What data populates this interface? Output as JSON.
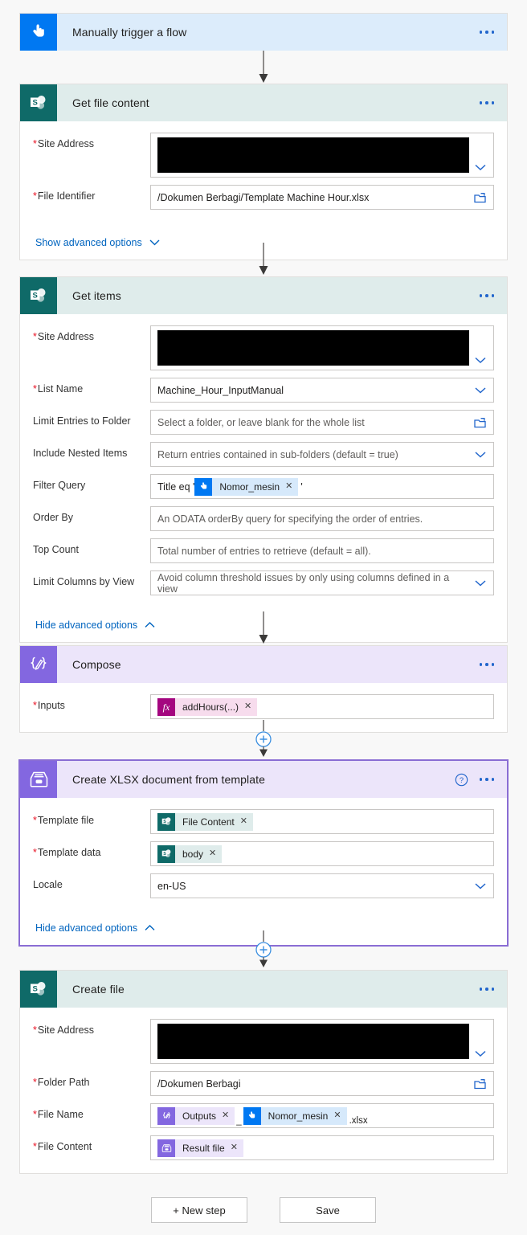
{
  "flow": {
    "steps": [
      {
        "id": "manual-trigger",
        "title": "Manually trigger a flow",
        "icon": "tap-hand-icon",
        "theme": "blue",
        "collapsed": true
      },
      {
        "id": "get-file-content",
        "title": "Get file content",
        "icon": "sharepoint-icon",
        "theme": "teal",
        "fields": [
          {
            "label": "Site Address",
            "required": true,
            "value": "",
            "redacted": true,
            "control": "dropdown"
          },
          {
            "label": "File Identifier",
            "required": true,
            "value": "/Dokumen Berbagi/Template Machine Hour.xlsx",
            "control": "folder-picker"
          }
        ],
        "advanced_label": "Show advanced options",
        "advanced_state": "collapsed"
      },
      {
        "id": "get-items",
        "title": "Get items",
        "icon": "sharepoint-icon",
        "theme": "teal",
        "fields": [
          {
            "label": "Site Address",
            "required": true,
            "value": "",
            "redacted": true,
            "control": "dropdown"
          },
          {
            "label": "List Name",
            "required": true,
            "value": "Machine_Hour_InputManual",
            "control": "dropdown"
          },
          {
            "label": "Limit Entries to Folder",
            "required": false,
            "placeholder": "Select a folder, or leave blank for the whole list",
            "control": "folder-picker"
          },
          {
            "label": "Include Nested Items",
            "required": false,
            "placeholder": "Return entries contained in sub-folders (default = true)",
            "control": "dropdown"
          },
          {
            "label": "Filter Query",
            "required": false,
            "control": "tokens",
            "tokens": [
              {
                "kind": "text",
                "text": "Title eq '"
              },
              {
                "kind": "token",
                "label": "Nomor_mesin",
                "icon": "tap-hand-icon",
                "theme": "blue"
              },
              {
                "kind": "text",
                "text": "'"
              }
            ]
          },
          {
            "label": "Order By",
            "required": false,
            "placeholder": "An ODATA orderBy query for specifying the order of entries.",
            "control": "text"
          },
          {
            "label": "Top Count",
            "required": false,
            "placeholder": "Total number of entries to retrieve (default = all).",
            "control": "text"
          },
          {
            "label": "Limit Columns by View",
            "required": false,
            "placeholder": "Avoid column threshold issues by only using columns defined in a view",
            "control": "dropdown"
          }
        ],
        "advanced_label": "Hide advanced options",
        "advanced_state": "expanded"
      },
      {
        "id": "compose",
        "title": "Compose",
        "icon": "compose-braces-icon",
        "theme": "purple",
        "fields": [
          {
            "label": "Inputs",
            "required": true,
            "control": "tokens",
            "tokens": [
              {
                "kind": "token",
                "label": "addHours(...)",
                "icon": "function-fx-icon",
                "theme": "magenta"
              }
            ]
          }
        ]
      },
      {
        "id": "create-xlsx-from-template",
        "title": "Create XLSX document from template",
        "icon": "file-box-icon",
        "theme": "purple",
        "selected": true,
        "has_help": true,
        "fields": [
          {
            "label": "Template file",
            "required": true,
            "control": "tokens",
            "tokens": [
              {
                "kind": "token",
                "label": "File Content",
                "icon": "sharepoint-icon",
                "theme": "teal"
              }
            ]
          },
          {
            "label": "Template data",
            "required": true,
            "control": "tokens",
            "tokens": [
              {
                "kind": "token",
                "label": "body",
                "icon": "sharepoint-icon",
                "theme": "teal"
              }
            ]
          },
          {
            "label": "Locale",
            "required": false,
            "value": "en-US",
            "control": "dropdown"
          }
        ],
        "advanced_label": "Hide advanced options",
        "advanced_state": "expanded"
      },
      {
        "id": "create-file",
        "title": "Create file",
        "icon": "sharepoint-icon",
        "theme": "teal",
        "fields": [
          {
            "label": "Site Address",
            "required": true,
            "value": "",
            "redacted": true,
            "control": "dropdown"
          },
          {
            "label": "Folder Path",
            "required": true,
            "value": "/Dokumen Berbagi",
            "control": "folder-picker"
          },
          {
            "label": "File Name",
            "required": true,
            "control": "tokens",
            "tokens": [
              {
                "kind": "token",
                "label": "Outputs",
                "icon": "compose-braces-icon",
                "theme": "purple"
              },
              {
                "kind": "text",
                "text": "_"
              },
              {
                "kind": "token",
                "label": "Nomor_mesin",
                "icon": "tap-hand-icon",
                "theme": "blue"
              },
              {
                "kind": "text",
                "text": ".xlsx"
              }
            ]
          },
          {
            "label": "File Content",
            "required": true,
            "control": "tokens",
            "tokens": [
              {
                "kind": "token",
                "label": "Result file",
                "icon": "file-box-icon",
                "theme": "purple"
              }
            ]
          }
        ]
      }
    ],
    "insert_buttons": [
      {
        "id": "insert-after-compose",
        "icon": "plus-circle-icon"
      },
      {
        "id": "insert-after-xlsx",
        "icon": "plus-circle-icon"
      }
    ]
  },
  "footer": {
    "new_step_label": "+ New step",
    "save_label": "Save"
  },
  "token_remove_glyph": "✕",
  "colors": {
    "trigger_blue": "#0078f2",
    "sharepoint_teal": "#0f6a68",
    "flow_purple": "#8367e0",
    "selected_border": "#8a6dd4",
    "link_blue": "#0064bf",
    "required_red": "#e81123"
  }
}
